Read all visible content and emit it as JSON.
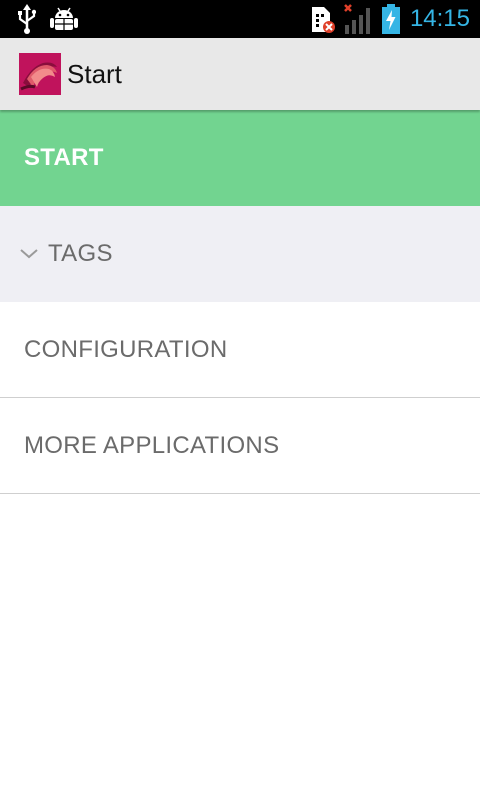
{
  "status_bar": {
    "time": "14:15",
    "icons": [
      "usb-icon",
      "android-debug-icon",
      "sim-error-icon",
      "signal-no-service-icon",
      "battery-charging-icon"
    ]
  },
  "action_bar": {
    "app_icon": "app-logo-icon",
    "title": "Start"
  },
  "menu": {
    "items": [
      {
        "label": "START",
        "selected": true
      },
      {
        "label": "TAGS",
        "expandable": true,
        "icon": "chevron-down-icon"
      },
      {
        "label": "CONFIGURATION"
      },
      {
        "label": "MORE APPLICATIONS"
      }
    ]
  },
  "colors": {
    "status_bar_bg": "#000000",
    "status_accent": "#35b5e5",
    "action_bar_bg": "#e8e8e8",
    "selected_item_bg": "#72d490",
    "tags_item_bg": "#efeff4",
    "item_text": "#6b6b6b"
  }
}
